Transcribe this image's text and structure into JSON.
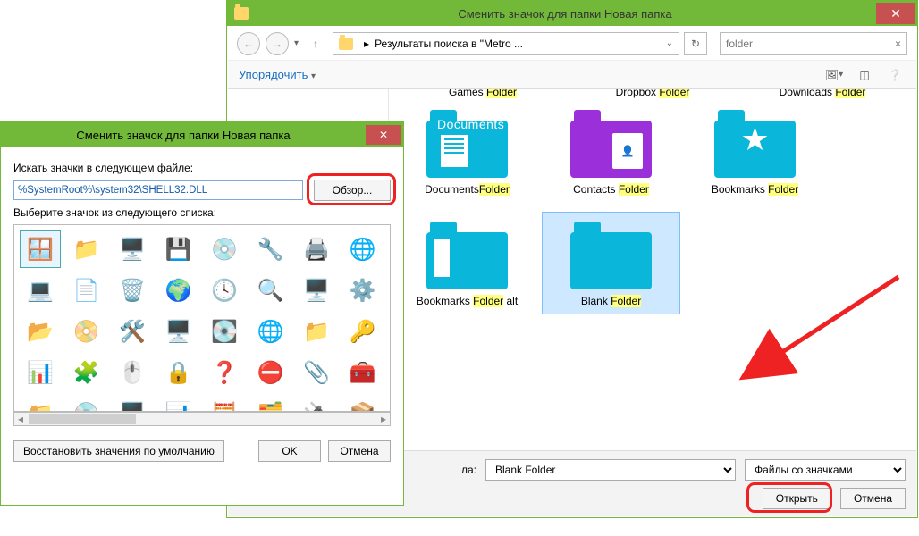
{
  "main": {
    "title": "Сменить значок для папки Новая папка",
    "nav": {
      "back": "←",
      "fwd": "→",
      "up": "↑",
      "address": "Результаты поиска в \"Metro ...",
      "search_value": "folder",
      "search_clear": "×",
      "refresh": "↻"
    },
    "toolbar": {
      "organize": "Упорядочить",
      "chev": "▾"
    },
    "trunc": [
      {
        "pre": "Games ",
        "hl": "Folder"
      },
      {
        "pre": "Dropbox ",
        "hl": "Folder"
      },
      {
        "pre": "Downloads ",
        "hl": "Folder"
      }
    ],
    "items": [
      {
        "name": "Documents",
        "hl": "Folder",
        "color": "cyan",
        "kind": "documents"
      },
      {
        "name": "Contacts ",
        "hl": "Folder",
        "color": "purple",
        "kind": "contacts"
      },
      {
        "name": "Bookmarks ",
        "hl": "Folder",
        "color": "cyan",
        "kind": "bookmarks"
      },
      {
        "name": "Bookmarks ",
        "hl": "Folder",
        "suffix": " alt",
        "color": "cyan",
        "kind": "ribbon"
      },
      {
        "name": "Blank ",
        "hl": "Folder",
        "color": "cyan",
        "kind": "blank",
        "selected": true
      }
    ],
    "docs_overlay": "Documents",
    "bottom": {
      "name_label": "ла:",
      "name_value": "Blank Folder",
      "type_value": "Файлы со значками",
      "open": "Открыть",
      "cancel": "Отмена"
    }
  },
  "dlg": {
    "title": "Сменить значок для папки Новая папка",
    "label_path": "Искать значки в следующем файле:",
    "path_value": "%SystemRoot%\\system32\\SHELL32.DLL",
    "browse": "Обзор...",
    "label_list": "Выберите значок из следующего списка:",
    "restore": "Восстановить значения по умолчанию",
    "ok": "OK",
    "cancel": "Отмена"
  },
  "icons": [
    "🪟",
    "📁",
    "🖥️",
    "💾",
    "💿",
    "🔧",
    "🖨️",
    "🌐",
    "💻",
    "📄",
    "🗑️",
    "🌍",
    "🕓",
    "🔍",
    "🖥️",
    "⚙️",
    "📂",
    "📀",
    "🛠️",
    "🖥️",
    "💽",
    "🌐",
    "📁",
    "🔑",
    "📊",
    "🧩",
    "🖱️",
    "🔒",
    "❓",
    "⛔",
    "📎",
    "🧰",
    "📁",
    "💿",
    "🖥️",
    "📊",
    "🧮",
    "🗂️",
    "🔌",
    "📦"
  ]
}
